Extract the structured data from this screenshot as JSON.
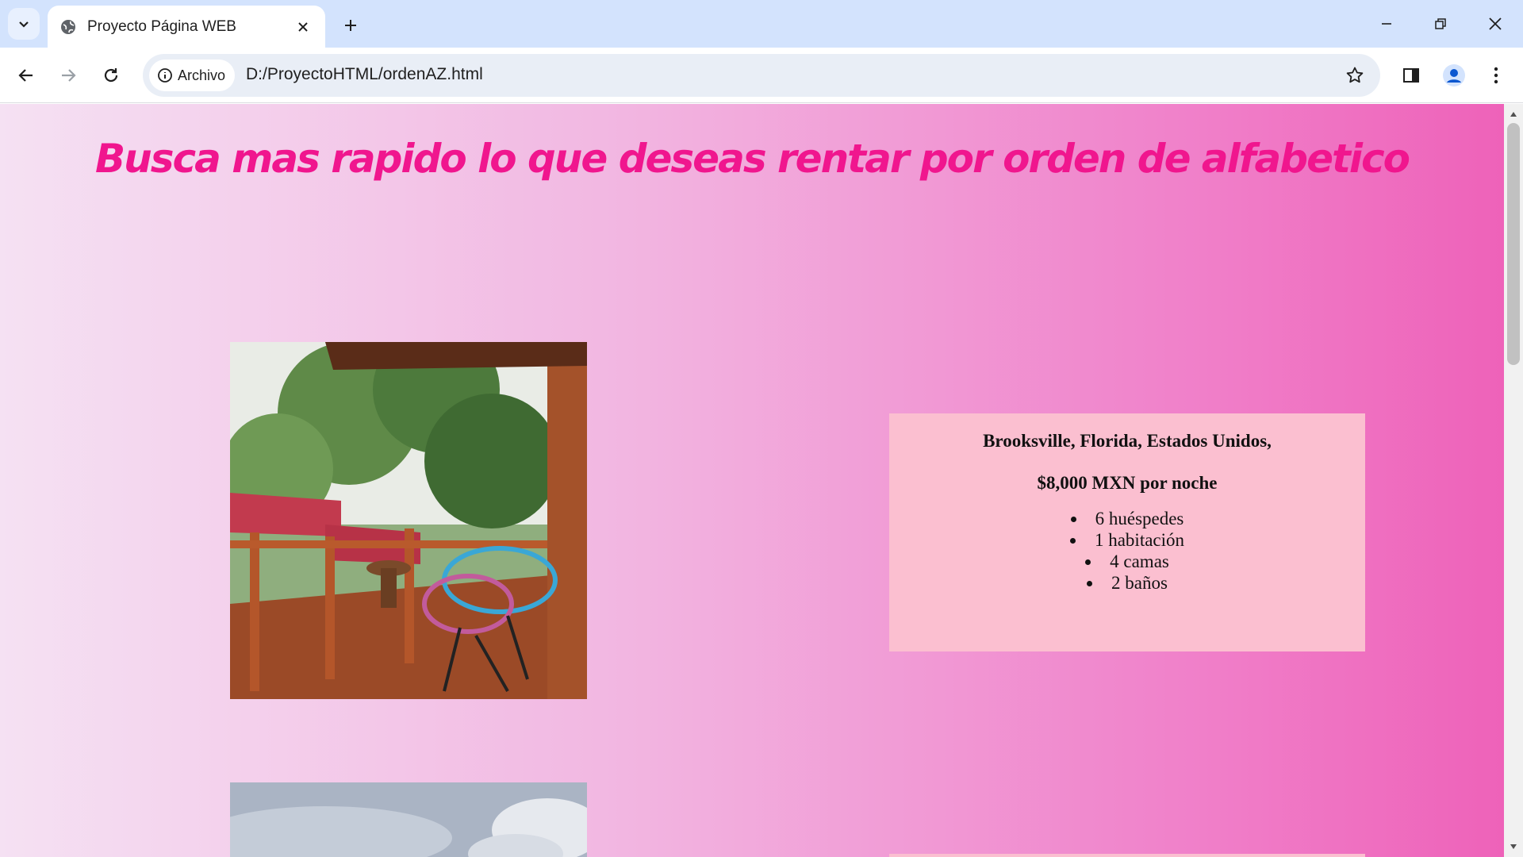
{
  "browser": {
    "tab_title": "Proyecto Página WEB",
    "address_chip": "Archivo",
    "url": "D:/ProyectoHTML/ordenAZ.html"
  },
  "page": {
    "heading": "Busca mas rapido lo que deseas rentar por orden de alfabetico",
    "listing": {
      "location": "Brooksville, Florida, Estados Unidos,",
      "price": "$8,000 MXN por noche",
      "features": [
        "6 huéspedes",
        "1 habitación",
        "4 camas",
        "2 baños"
      ]
    }
  },
  "colors": {
    "heading": "#f0168e",
    "card_background": "#fbbfd0",
    "tabbar": "#d3e3fd"
  }
}
